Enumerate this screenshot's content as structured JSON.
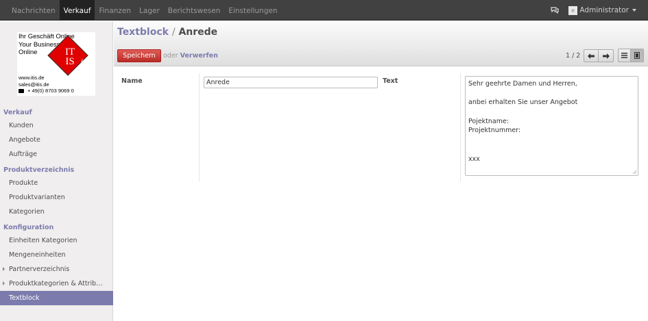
{
  "topbar": {
    "menu": [
      "Nachrichten",
      "Verkauf",
      "Finanzen",
      "Lager",
      "Berichtswesen",
      "Einstellungen"
    ],
    "active_menu": "Verkauf",
    "user": "Administrator"
  },
  "logo": {
    "line1": "Ihr Geschäft Online",
    "line2": "Your Business",
    "line3": "Online",
    "mark_top": "IT",
    "mark_bottom": "IS",
    "mark_ag": "AG",
    "web": "www.itis.de",
    "email": "sales@itis.de",
    "phone": "+ 49(0) 8703 9069 0"
  },
  "sidebar": {
    "sections": [
      {
        "title": "Verkauf",
        "items": [
          "Kunden",
          "Angebote",
          "Aufträge"
        ]
      },
      {
        "title": "Produktverzeichnis",
        "items": [
          "Produkte",
          "Produktvarianten",
          "Kategorien"
        ]
      },
      {
        "title": "Konfiguration",
        "items": [
          "Einheiten Kategorien",
          "Mengeneinheiten",
          "Partnerverzeichnis",
          "Produktkategorien & Attrib…",
          "Textblock"
        ]
      }
    ],
    "active_item": "Textblock"
  },
  "breadcrumb": {
    "parent": "Textblock",
    "separator": "/",
    "current": "Anrede"
  },
  "toolbar": {
    "save_label": "Speichern",
    "or_label": "oder",
    "discard_label": "Verwerfen",
    "pager": "1 / 2"
  },
  "form": {
    "name_label": "Name",
    "name_value": "Anrede",
    "text_label": "Text",
    "text_lines": [
      "Sehr geehrte Damen und Herren,",
      "",
      "anbei erhalten Sie unser Angebot",
      "",
      "Pojektname:",
      "Projektnummer:",
      "",
      "",
      "xxx"
    ]
  },
  "colors": {
    "accent": "#7c7bad",
    "save": "#dc5f59",
    "topbar": "#414141"
  },
  "icons": [
    "chat-icon",
    "avatar",
    "chevron-down-icon",
    "arrow-left-icon",
    "arrow-right-icon",
    "list-view-icon",
    "form-view-icon",
    "phone-icon",
    "resize-grip-icon"
  ]
}
